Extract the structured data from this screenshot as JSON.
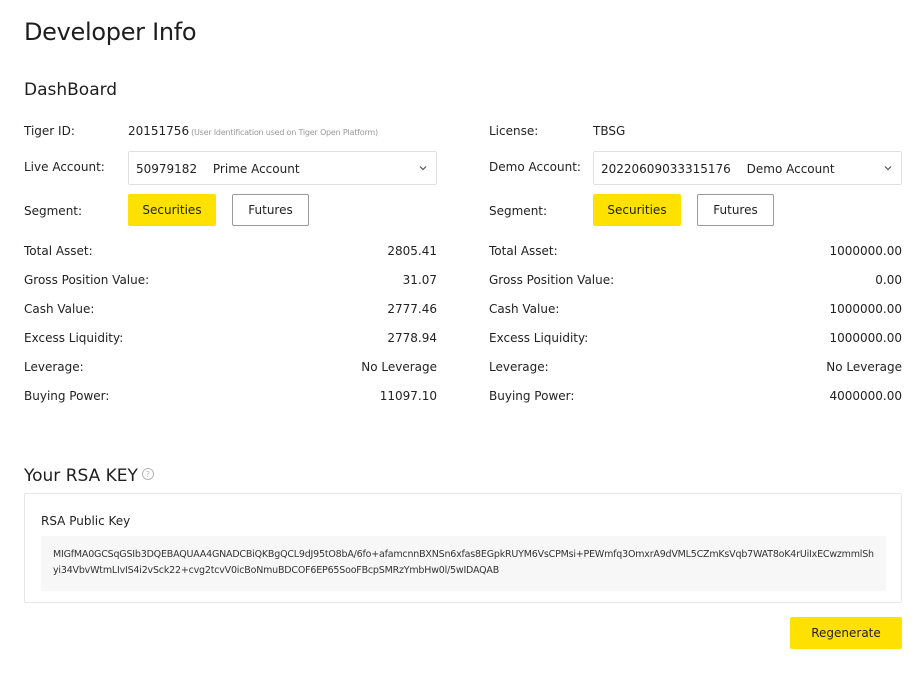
{
  "page": {
    "title": "Developer Info"
  },
  "dashboard": {
    "title": "DashBoard",
    "left": {
      "id_label": "Tiger ID:",
      "id_value": "20151756",
      "id_note": "(User Identification used on Tiger Open Platform)",
      "account_label": "Live Account:",
      "account_number": "50979182",
      "account_type": "Prime Account",
      "segment_label": "Segment:",
      "segment_options": [
        "Securities",
        "Futures"
      ],
      "segment_selected": "Securities",
      "metrics": [
        {
          "label": "Total Asset:",
          "value": "2805.41"
        },
        {
          "label": "Gross Position Value:",
          "value": "31.07"
        },
        {
          "label": "Cash Value:",
          "value": "2777.46"
        },
        {
          "label": "Excess Liquidity:",
          "value": "2778.94"
        },
        {
          "label": "Leverage:",
          "value": "No Leverage"
        },
        {
          "label": "Buying Power:",
          "value": "11097.10"
        }
      ]
    },
    "right": {
      "license_label": "License:",
      "license_value": "TBSG",
      "account_label": "Demo Account:",
      "account_number": "20220609033315176",
      "account_type": "Demo Account",
      "segment_label": "Segment:",
      "segment_options": [
        "Securities",
        "Futures"
      ],
      "segment_selected": "Securities",
      "metrics": [
        {
          "label": "Total Asset:",
          "value": "1000000.00"
        },
        {
          "label": "Gross Position Value:",
          "value": "0.00"
        },
        {
          "label": "Cash Value:",
          "value": "1000000.00"
        },
        {
          "label": "Excess Liquidity:",
          "value": "1000000.00"
        },
        {
          "label": "Leverage:",
          "value": "No Leverage"
        },
        {
          "label": "Buying Power:",
          "value": "4000000.00"
        }
      ]
    }
  },
  "rsa": {
    "title": "Your RSA KEY",
    "help_icon": "question-circle-icon",
    "label": "RSA Public Key",
    "key": "MIGfMA0GCSqGSIb3DQEBAQUAA4GNADCBiQKBgQCL9dJ95tO8bA/6fo+afamcnnBXNSn6xfas8EGpkRUYM6VsCPMsi+PEWmfq3OmxrA9dVML5CZmKsVqb7WAT8oK4rUiIxECwzmmlShyi34VbvWtmLIvIS4i2vSck22+cvg2tcvV0icBoNmuBDCOF6EP65SooFBcpSMRzYmbHw0l/5wIDAQAB",
    "regenerate_label": "Regenerate"
  },
  "colors": {
    "accent": "#ffe100",
    "border": "#e0e0e0",
    "key_bg": "#f7f7f7"
  }
}
